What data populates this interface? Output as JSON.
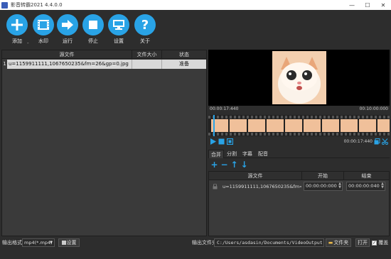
{
  "window": {
    "title": "影音转霸2021 4.4.0.0"
  },
  "toolbar": {
    "add": "添加",
    "watermark": "水印",
    "run": "运行",
    "stop": "停止",
    "settings": "设置",
    "about": "关于",
    "drop_mark": "-"
  },
  "file_list": {
    "columns": [
      "源文件",
      "文件大小",
      "状态"
    ],
    "rows": [
      {
        "num": "1",
        "source": "u=1159911111,1067650235&fm=26&gp=0.jpg",
        "size": "",
        "status": "准备"
      }
    ]
  },
  "player": {
    "time_start": "00:00:17:440",
    "time_end": "00:10:00:000",
    "current_time": "00:00:17:440"
  },
  "tabs": [
    "合并",
    "分割",
    "字幕",
    "配音"
  ],
  "clip_table": {
    "columns": [
      "源文件",
      "开始",
      "结束"
    ],
    "rows": [
      {
        "source": "u=1159911111,1067650235&fm=26...",
        "start": "00:00:00:000",
        "end": "00:00:00:040"
      }
    ]
  },
  "bottom": {
    "output_format_label": "输出格式",
    "output_format_value": "mp4(*.mp4)",
    "settings_label": "设置",
    "output_folder_label": "输出文件夹",
    "output_path": "C:/Users/asdasin/Documents/VideoOutput",
    "folder_button": "文件夹",
    "open_button": "打开",
    "overwrite_label": "覆盖"
  },
  "colors": {
    "accent": "#29a3e6",
    "background": "#2d2d2d",
    "selected_row": "#d9d9d9"
  }
}
